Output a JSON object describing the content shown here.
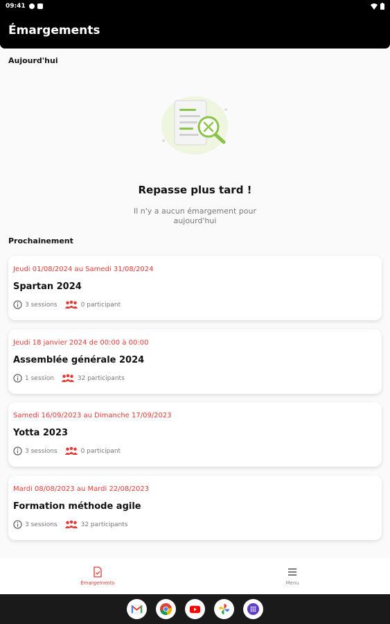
{
  "status_bar": {
    "time": "09:41"
  },
  "app_bar": {
    "title": "Émargements"
  },
  "today": {
    "section_label": "Aujourd'hui",
    "empty_title": "Repasse plus tard !",
    "empty_description": "Il n'y a aucun émargement pour aujourd'hui"
  },
  "upcoming": {
    "section_label": "Prochainement",
    "events": [
      {
        "date": "Jeudi 01/08/2024 au Samedi 31/08/2024",
        "name": "Spartan 2024",
        "sessions": "3 sessions",
        "participants": "0 participant"
      },
      {
        "date": "Jeudi 18 janvier 2024 de 00:00 à 00:00",
        "name": "Assemblée générale 2024",
        "sessions": "1 session",
        "participants": "32 participants"
      },
      {
        "date": "Samedi 16/09/2023 au Dimanche 17/09/2023",
        "name": "Yotta 2023",
        "sessions": "3 sessions",
        "participants": "0 participant"
      },
      {
        "date": "Mardi 08/08/2023 au Mardi 22/08/2023",
        "name": "Formation méthode agile",
        "sessions": "3 sessions",
        "participants": "32 participants"
      }
    ]
  },
  "bottom_nav": {
    "items": [
      {
        "label": "Émargements",
        "icon": "document-check-icon",
        "active": true
      },
      {
        "label": "Menu",
        "icon": "hamburger-menu-icon",
        "active": false
      }
    ]
  },
  "dock": {
    "apps": [
      "gmail-icon",
      "chrome-icon",
      "youtube-icon",
      "photos-icon",
      "app-drawer-icon"
    ]
  },
  "colors": {
    "accent": "#e53935",
    "app_bar": "#000000",
    "background": "#fafafa",
    "illustration_green": "#8bc34a"
  }
}
